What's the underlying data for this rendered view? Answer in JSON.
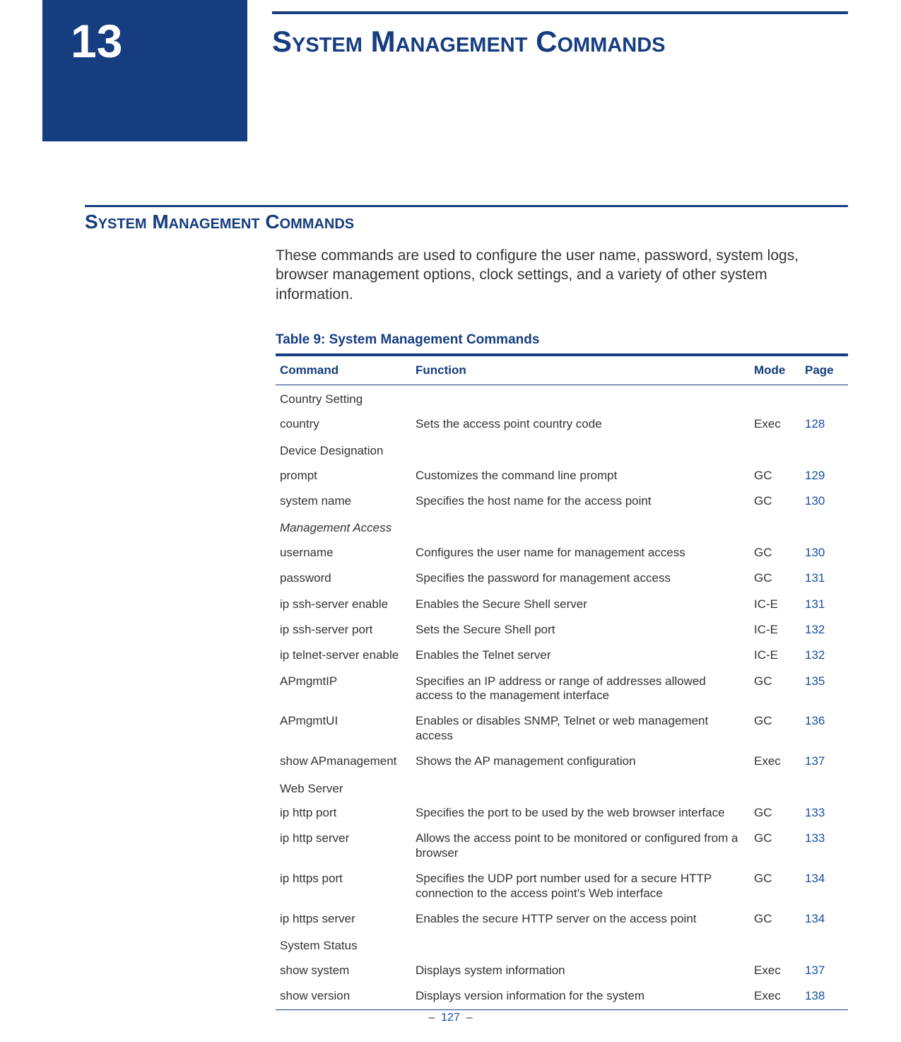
{
  "chapter": {
    "number": "13",
    "title": "System Management Commands"
  },
  "section": {
    "title": "System Management Commands",
    "intro": "These commands are used to configure the user name, password, system logs, browser management options, clock settings, and a variety of other system information."
  },
  "table": {
    "caption": "Table 9: System Management Commands",
    "headers": {
      "command": "Command",
      "function": "Function",
      "mode": "Mode",
      "page": "Page"
    },
    "rows": [
      {
        "type": "section",
        "label": "Country Setting",
        "italic": false
      },
      {
        "type": "row",
        "command": "country",
        "function": "Sets the access point country code",
        "mode": "Exec",
        "page": "128"
      },
      {
        "type": "section",
        "label": "Device Designation",
        "italic": false
      },
      {
        "type": "row",
        "command": "prompt",
        "function": "Customizes the command line prompt",
        "mode": "GC",
        "page": "129"
      },
      {
        "type": "row",
        "command": "system name",
        "function": "Specifies the host name for the access point",
        "mode": "GC",
        "page": "130"
      },
      {
        "type": "section",
        "label": "Management Access",
        "italic": true
      },
      {
        "type": "row",
        "command": "username",
        "function": "Configures the user name for management access",
        "mode": "GC",
        "page": "130"
      },
      {
        "type": "row",
        "command": "password",
        "function": "Specifies the password for management access",
        "mode": "GC",
        "page": "131"
      },
      {
        "type": "row",
        "command": "ip ssh-server enable",
        "function": "Enables the Secure Shell server",
        "mode": "IC-E",
        "page": "131"
      },
      {
        "type": "row",
        "command": "ip ssh-server port",
        "function": "Sets the Secure Shell port",
        "mode": "IC-E",
        "page": "132"
      },
      {
        "type": "row",
        "command": "ip telnet-server enable",
        "function": "Enables the Telnet server",
        "mode": "IC-E",
        "page": "132"
      },
      {
        "type": "row",
        "command": "APmgmtIP",
        "function": "Specifies an IP address or range of addresses allowed access to the management interface",
        "mode": "GC",
        "page": "135"
      },
      {
        "type": "row",
        "command": "APmgmtUI",
        "function": "Enables or disables SNMP, Telnet or web management access",
        "mode": "GC",
        "page": "136"
      },
      {
        "type": "row",
        "command": "show APmanagement",
        "function": "Shows the AP management configuration",
        "mode": "Exec",
        "page": "137"
      },
      {
        "type": "section",
        "label": "Web Server",
        "italic": false
      },
      {
        "type": "row",
        "command": "ip http port",
        "function": "Specifies the port to be used by the web browser interface",
        "mode": "GC",
        "page": "133"
      },
      {
        "type": "row",
        "command": "ip http server",
        "function": "Allows the access point to be monitored or configured from a browser",
        "mode": "GC",
        "page": "133"
      },
      {
        "type": "row",
        "command": "ip https port",
        "function": "Specifies the UDP port number used for a secure HTTP connection to the access point's Web interface",
        "mode": "GC",
        "page": "134"
      },
      {
        "type": "row",
        "command": "ip https server",
        "function": "Enables the secure HTTP server on the access point",
        "mode": "GC",
        "page": "134"
      },
      {
        "type": "section",
        "label": "System Status",
        "italic": false
      },
      {
        "type": "row",
        "command": "show system",
        "function": "Displays system information",
        "mode": "Exec",
        "page": "137"
      },
      {
        "type": "row",
        "command": "show version",
        "function": "Displays version information for the system",
        "mode": "Exec",
        "page": "138"
      }
    ]
  },
  "footer": {
    "dash": "–",
    "page_number": "127"
  }
}
